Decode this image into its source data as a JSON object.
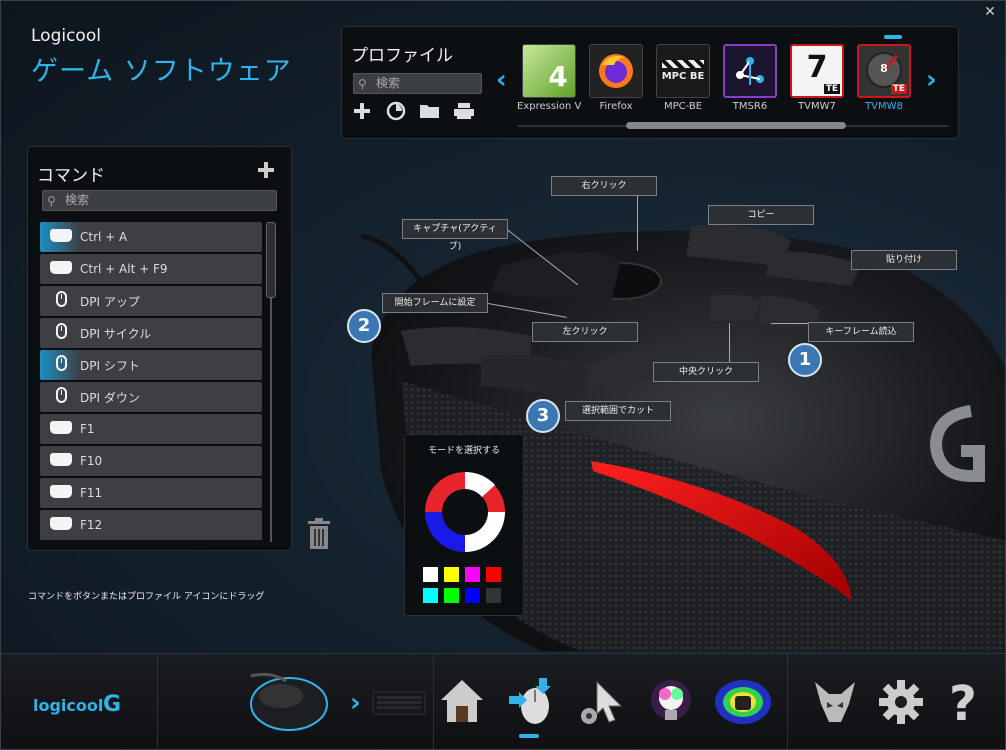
{
  "app": {
    "brand_small": "Logicool",
    "brand_large": "ゲーム ソフトウェア",
    "close_glyph": "✕"
  },
  "profiles": {
    "title": "プロファイル",
    "search_placeholder": "検索",
    "items": [
      {
        "label": "Expression V",
        "icon": "expression-web-icon"
      },
      {
        "label": "Firefox",
        "icon": "firefox-icon"
      },
      {
        "label": "MPC-BE",
        "icon": "mpc-be-icon"
      },
      {
        "label": "TMSR6",
        "icon": "tmsr6-icon"
      },
      {
        "label": "TVMW7",
        "icon": "tvmw7-icon"
      },
      {
        "label": "TVMW8",
        "icon": "tvmw8-icon",
        "active": true
      }
    ],
    "thumb_texts": {
      "expression": "4",
      "mpc": "MPC BE",
      "te": "TE",
      "seven": "7",
      "eight": "8"
    }
  },
  "commands": {
    "title": "コマンド",
    "search_placeholder": "検索",
    "items": [
      {
        "label": "Ctrl + A",
        "icon": "key-icon",
        "highlight": true
      },
      {
        "label": "Ctrl + Alt + F9",
        "icon": "key-icon"
      },
      {
        "label": "DPI アップ",
        "icon": "mouse-icon"
      },
      {
        "label": "DPI サイクル",
        "icon": "mouse-icon"
      },
      {
        "label": "DPI シフト",
        "icon": "mouse-icon",
        "highlight": true
      },
      {
        "label": "DPI ダウン",
        "icon": "mouse-icon"
      },
      {
        "label": "F1",
        "icon": "key-icon"
      },
      {
        "label": "F10",
        "icon": "key-icon"
      },
      {
        "label": "F11",
        "icon": "key-icon"
      },
      {
        "label": "F12",
        "icon": "key-icon"
      }
    ],
    "hint": "コマンドをボタンまたはプロファイル アイコンにドラッグ"
  },
  "button_labels": {
    "right_click": "右クリック",
    "copy": "コピー",
    "capture": "キャプチャ(アクティブ)",
    "paste": "貼り付け",
    "set_start_frame": "開始フレームに設定",
    "left_click": "左クリック",
    "keyframe_read": "キーフレーム読込",
    "middle_click": "中央クリック",
    "cut_selection": "選択範囲でカット"
  },
  "badges": {
    "one": "1",
    "two": "2",
    "three": "3"
  },
  "mode": {
    "title": "モードを選択する",
    "swatches": [
      "#ffffff",
      "#ffff00",
      "#ff00ff",
      "#ff0000",
      "#00ffff",
      "#00ff00",
      "#0000ff",
      "#333333"
    ]
  },
  "bottom": {
    "logo_text": "logicool",
    "logo_g": "G",
    "help": "?"
  }
}
